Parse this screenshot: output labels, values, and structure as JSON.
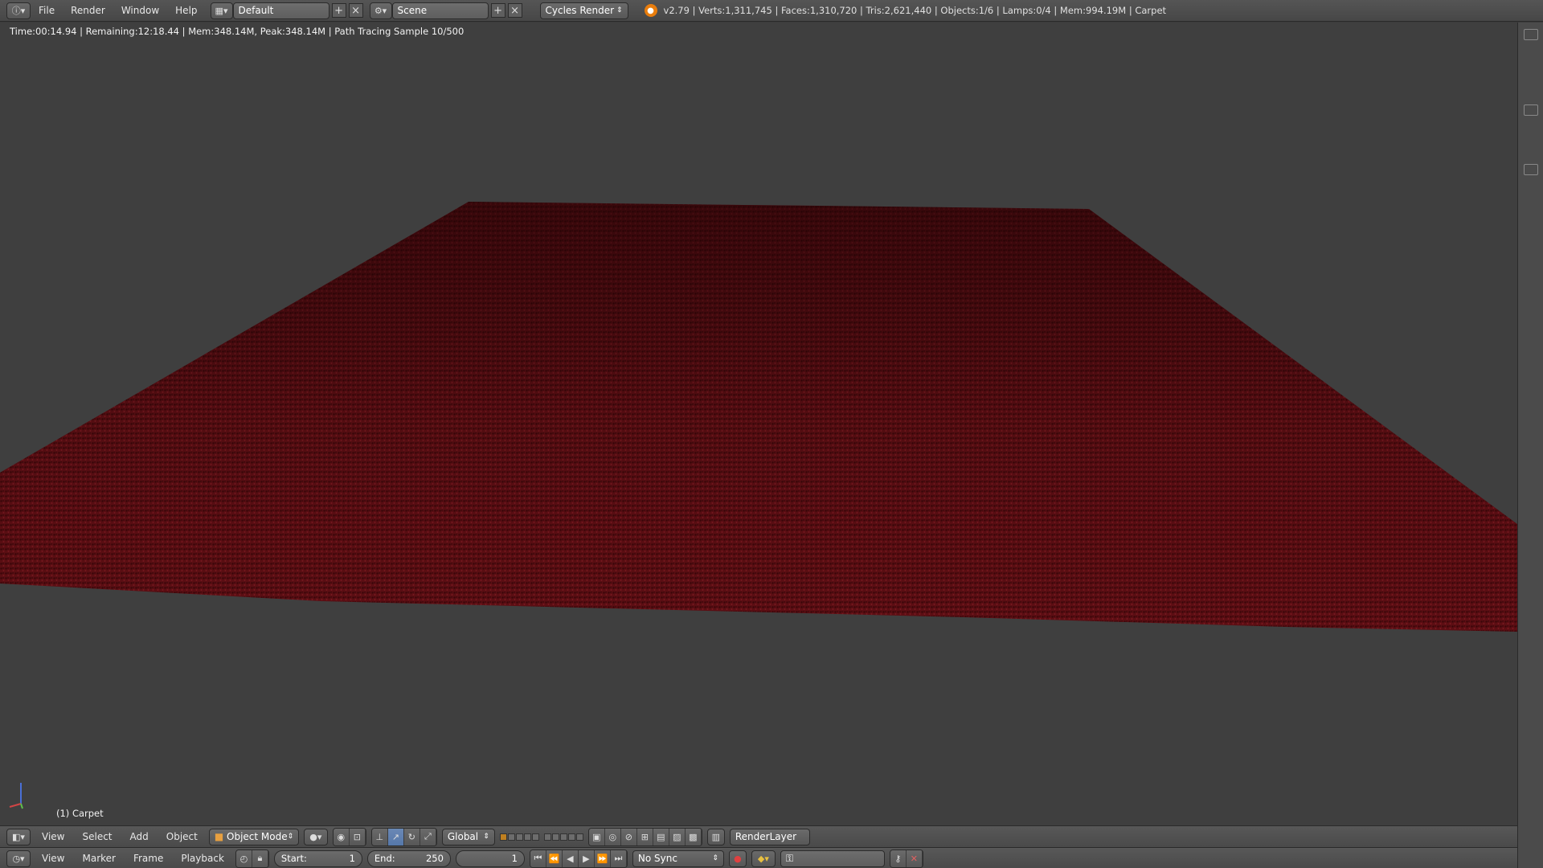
{
  "info_header": {
    "menus": [
      "File",
      "Render",
      "Window",
      "Help"
    ],
    "screen_layout": "Default",
    "scene": "Scene",
    "render_engine": "Cycles Render",
    "stats": "v2.79 | Verts:1,311,745 | Faces:1,310,720 | Tris:2,621,440 | Objects:1/6 | Lamps:0/4 | Mem:994.19M | Carpet"
  },
  "viewport": {
    "render_status": "Time:00:14.94 | Remaining:12:18.44 | Mem:348.14M, Peak:348.14M | Path Tracing Sample 10/500",
    "object_label": "(1) Carpet",
    "colors": {
      "background": "#3f3f3f",
      "carpet": "#5a0d12",
      "carpet_shadow": "#2a0507"
    }
  },
  "view3d_header": {
    "menus": [
      "View",
      "Select",
      "Add",
      "Object"
    ],
    "mode": "Object Mode",
    "orientation": "Global",
    "render_layer": "RenderLayer"
  },
  "timeline_header": {
    "menus": [
      "View",
      "Marker",
      "Frame",
      "Playback"
    ],
    "start_label": "Start:",
    "start_value": "1",
    "end_label": "End:",
    "end_value": "250",
    "current_frame": "1",
    "sync": "No Sync"
  }
}
